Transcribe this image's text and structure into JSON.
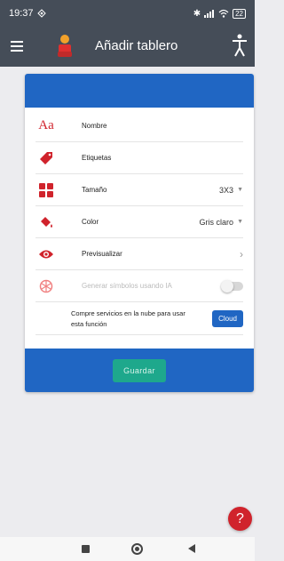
{
  "status_bar": {
    "time": "19:37",
    "battery": "22"
  },
  "app_bar": {
    "title": "Añadir tablero"
  },
  "form": {
    "rows": [
      {
        "label": "Nombre"
      },
      {
        "label": "Etiquetas"
      },
      {
        "label": "Tamaño",
        "value": "3X3"
      },
      {
        "label": "Color",
        "value": "Gris claro"
      },
      {
        "label": "Previsualizar"
      },
      {
        "label": "Generar símbolos usando IA"
      }
    ],
    "cloud_text_line1": "Compre servicios en la nube para usar",
    "cloud_text_line2": "esta función",
    "cloud_button": "Cloud",
    "save_button": "Guardar"
  },
  "help_fab": "?",
  "colors": {
    "primary": "#2066c3",
    "accent": "#d0232c",
    "appbar": "#454d58",
    "save": "#1ea88c"
  }
}
